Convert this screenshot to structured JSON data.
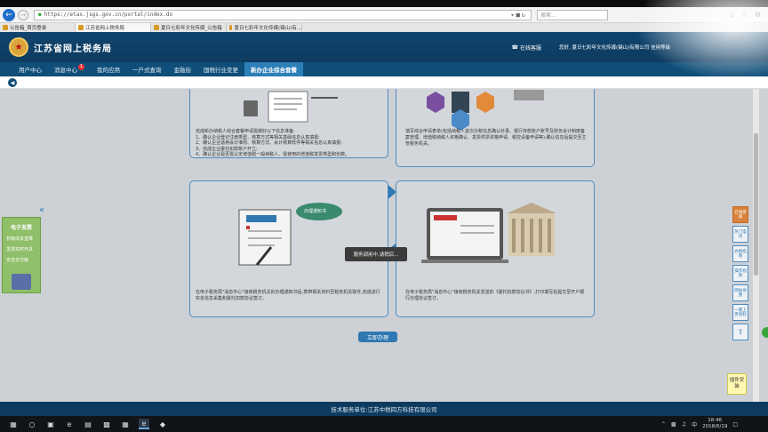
{
  "browser": {
    "url": "https://etax.jsgs.gov.cn/portal/index.do",
    "search_placeholder": "搜索...",
    "tabs": [
      {
        "label": "公告箱_首页登录"
      },
      {
        "label": "江苏省网上税务局"
      },
      {
        "label": "夏日七彩年文化传媒_公告箱"
      },
      {
        "label": "夏日七彩年文化传媒(锡山)有..."
      }
    ]
  },
  "header": {
    "site_title": "江苏省网上税务局",
    "online_service": "在线客服",
    "user_info": "您好, 夏日七彩年文化传媒(锡山)有限公司  信用等级"
  },
  "nav": {
    "items": [
      {
        "label": "用户中心"
      },
      {
        "label": "消息中心",
        "badge": "1"
      },
      {
        "label": "我的应用"
      },
      {
        "label": "一户式查询"
      },
      {
        "label": "金融街"
      },
      {
        "label": "国税行业变更"
      },
      {
        "label": "新办企业综合套餐"
      }
    ]
  },
  "steps": {
    "step1_text": "完成新办纳税人综合套餐申请需做好以下信息准备:\n1、确认企业登记注册类型、核算方式等相关基础信息认真填报;\n2、确认企业适用会计准则、核算方式、会计核算软件等相关信息认真填报;\n3、完成企业委托扣款账户开立;\n4、确认企业是否需认定增值税一般纳税人、需使用的增值税发票类型和份数。",
    "step2_text": "填写综合申请表单(包括纳税人首次办税信息确认补录、银行存款账户账号及财务会计制度备案管理、增值税纳税人资格确认、发票供票资格申请、税控设备申请等),确认信息后提交至主管税务机关。",
    "step3_text": "在电子税务局\"消息中心\"接收税务机关的办理通知书后,携带相关资料至税务机关取件,完成进行实名信息采集和委托扣款协议签订。",
    "step4_text": "在电子税务局\"消息中心\"接收税务机关发送的《委托扣款协议书》,打印填写后提交至开户银行办理协议签订。",
    "notice_label": "办理通知书"
  },
  "toast": "服务调用中,请稍后...",
  "apply_button": "立即办理",
  "left_panel": {
    "title": "电子发票",
    "items": [
      "初级成本直降",
      "发票实时开具",
      "安全支付链"
    ]
  },
  "right_bar": [
    {
      "label": "在线客服"
    },
    {
      "label": "热门电话"
    },
    {
      "label": "办税指南"
    },
    {
      "label": "操作视频"
    },
    {
      "label": "网站地图"
    },
    {
      "label": "一键上传资料"
    }
  ],
  "plugin_button": "插件安装",
  "footer": "技术服务单位:江苏中税四方科技有限公司",
  "taskbar": {
    "time": "18:46",
    "date": "2018/6/19",
    "ime": "中"
  }
}
